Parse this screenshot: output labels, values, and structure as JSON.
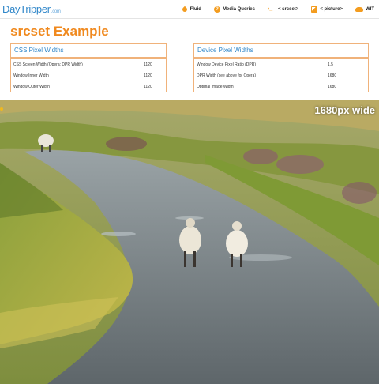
{
  "header": {
    "logo": "DayTripper",
    "logo_domain": ".com",
    "nav": [
      {
        "label": "Fluid",
        "icon": "drop-icon"
      },
      {
        "label": "Media Queries",
        "icon": "question-icon"
      },
      {
        "label": "< srcset>",
        "icon": "code-icon"
      },
      {
        "label": "< picture>",
        "icon": "picture-icon"
      },
      {
        "label": "WIT",
        "icon": "cloud-icon"
      }
    ]
  },
  "page_title": "srcset Example",
  "css_table": {
    "heading": "CSS Pixel Widths",
    "rows": [
      {
        "label": "CSS Screen Width (Opera: DPR Width)",
        "value": "1120"
      },
      {
        "label": "Window Inner Width",
        "value": "1120"
      },
      {
        "label": "Window Outer Width",
        "value": "1120"
      }
    ]
  },
  "device_table": {
    "heading": "Device Pixel Widths",
    "rows": [
      {
        "label": "Window Device Pixel Ratio (DPR)",
        "value": "1.5"
      },
      {
        "label": "DPR Width (see above for Opera)",
        "value": "1680"
      },
      {
        "label": "Optimal Image Width",
        "value": "1680"
      }
    ]
  },
  "image": {
    "overlay_label": "1680px wide"
  },
  "colors": {
    "accent_orange": "#f0891e",
    "link_blue": "#2f86c9",
    "table_border": "#f0b27a"
  }
}
